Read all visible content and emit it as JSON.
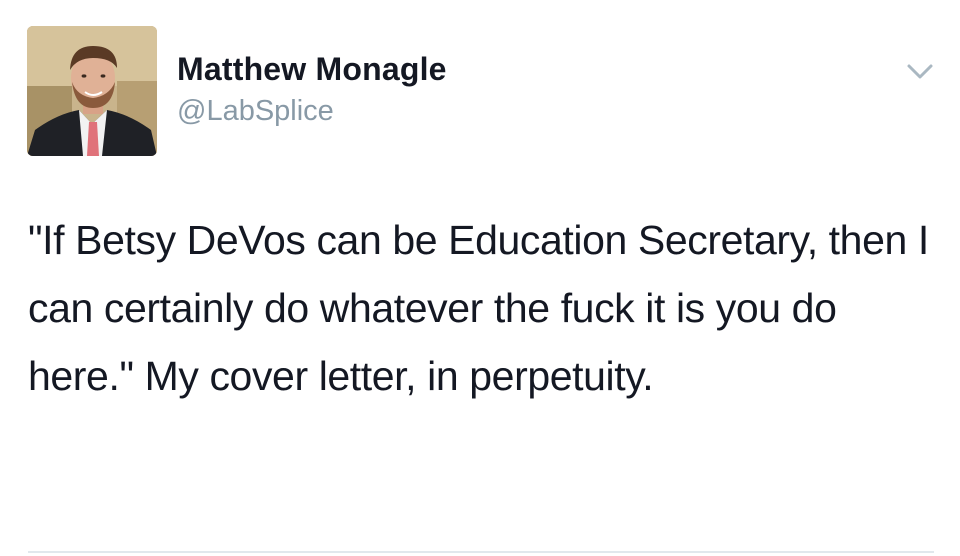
{
  "tweet": {
    "author": {
      "name": "Matthew Monagle",
      "handle": "@LabSplice",
      "avatar_icon": "profile-photo"
    },
    "menu_icon": "chevron-down-icon",
    "text": "\"If Betsy DeVos can be Education Secretary, then I can certainly do whatever the fuck it is you do here.\" My cover letter, in perpetuity."
  },
  "colors": {
    "name": "#141823",
    "handle": "#8899a6",
    "chevron": "#aab8c2",
    "divider": "#e1e8ed"
  }
}
